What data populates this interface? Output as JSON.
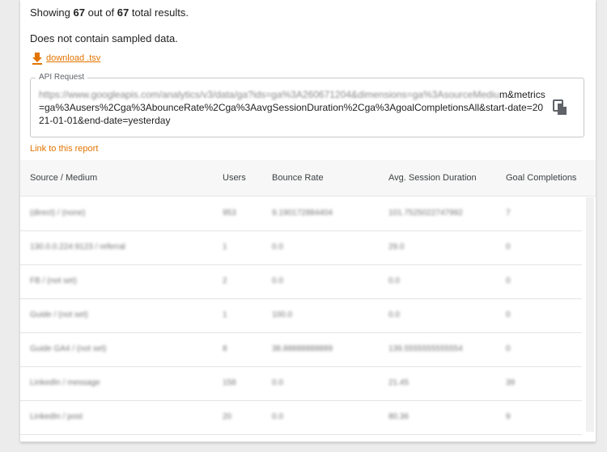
{
  "summary": {
    "prefix": "Showing",
    "shown": "67",
    "middle": "out of",
    "total": "67",
    "suffix": "total results."
  },
  "sampled_note": "Does not contain sampled data.",
  "download": {
    "label": "download .tsv",
    "icon": "download-icon",
    "color": "#e37400"
  },
  "api_request": {
    "legend": "API Request",
    "blurred_prefix": "https://www.googleapis.com/analytics/v3/data/ga?ids=ga%3A260671204&dimensions=ga%3AsourceMediu",
    "visible_text": "m&metrics=ga%3Ausers%2Cga%3AbounceRate%2Cga%3AavgSessionDuration%2Cga%3AgoalCompletionsAll&start-date=2021-01-01&end-date=yesterday",
    "copy_icon": "copy-icon"
  },
  "link_to_report": "Link to this report",
  "table": {
    "headers": [
      "Source / Medium",
      "Users",
      "Bounce Rate",
      "Avg. Session Duration",
      "Goal Completions"
    ],
    "rows": [
      [
        "(direct) / (none)",
        "953",
        "9.190172884404",
        "101.7525022747992",
        "7"
      ],
      [
        "130.0.0.224:9123 / referral",
        "1",
        "0.0",
        "29.0",
        "0"
      ],
      [
        "FB / (not set)",
        "2",
        "0.0",
        "0.0",
        "0"
      ],
      [
        "Guide / (not set)",
        "1",
        "100.0",
        "0.0",
        "0"
      ],
      [
        "Guide GA4 / (not set)",
        "8",
        "38.88888888889",
        "139.5555555555554",
        "0"
      ],
      [
        "LinkedIn / message",
        "158",
        "0.0",
        "21.45",
        "39"
      ],
      [
        "LinkedIn / post",
        "20",
        "0.0",
        "80.36",
        "9"
      ]
    ]
  }
}
